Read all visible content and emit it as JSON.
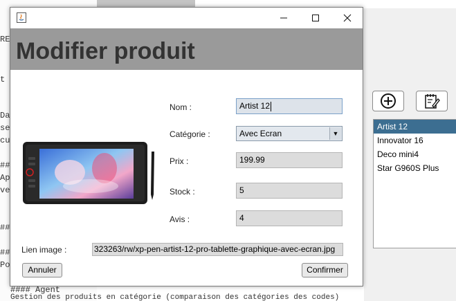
{
  "background": {
    "editor_lines": [
      "RE",
      "t fi",
      "Dan",
      "se",
      "cup",
      "##",
      "App",
      "ven",
      "##",
      "###",
      "Pos"
    ],
    "bottom_line": "#### Agent",
    "bottom_line_2": "Gestion des produits en catégorie (comparaison des catégories des codes)"
  },
  "dialog": {
    "title": "Modifier produit",
    "fields": {
      "nom": {
        "label": "Nom :",
        "value": "Artist 12"
      },
      "categorie": {
        "label": "Catégorie :",
        "value": "Avec Ecran"
      },
      "prix": {
        "label": "Prix :",
        "value": "199.99"
      },
      "stock": {
        "label": "Stock :",
        "value": "5"
      },
      "avis": {
        "label": "Avis :",
        "value": "4"
      }
    },
    "lien_image": {
      "label": "Lien image :",
      "value": "323263/rw/xp-pen-artist-12-pro-tablette-graphique-avec-ecran.jpg"
    },
    "buttons": {
      "cancel": "Annuler",
      "confirm": "Confirmer"
    }
  },
  "products": {
    "items": [
      "Artist 12",
      "Innovator 16",
      "Deco mini4",
      "Star G960S Plus"
    ],
    "selected_index": 0
  },
  "colors": {
    "header": "#9a9a9a",
    "selection": "#3c6e91",
    "field_bg": "#dcdcdc"
  },
  "icons": [
    "java-icon",
    "minimize-icon",
    "maximize-icon",
    "close-icon",
    "add-circle-icon",
    "edit-notepad-icon"
  ]
}
